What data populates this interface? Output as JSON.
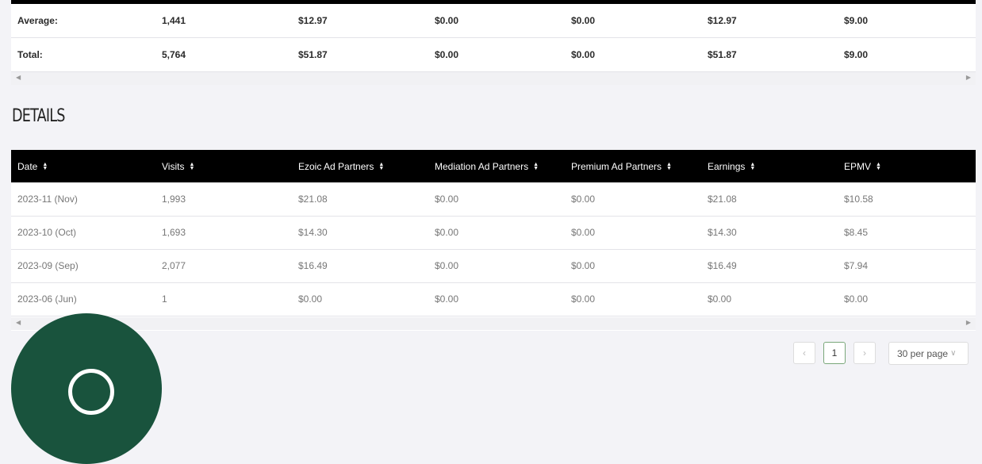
{
  "summary": {
    "rows": [
      {
        "label": "Average:",
        "visits": "1,441",
        "ezoic": "$12.97",
        "mediation": "$0.00",
        "premium": "$0.00",
        "earnings": "$12.97",
        "epmv": "$9.00"
      },
      {
        "label": "Total:",
        "visits": "5,764",
        "ezoic": "$51.87",
        "mediation": "$0.00",
        "premium": "$0.00",
        "earnings": "$51.87",
        "epmv": "$9.00"
      }
    ]
  },
  "details": {
    "title": "DETAILS",
    "headers": [
      "Date",
      "Visits",
      "Ezoic Ad Partners",
      "Mediation Ad Partners",
      "Premium Ad Partners",
      "Earnings",
      "EPMV"
    ],
    "rows": [
      [
        "2023-11 (Nov)",
        "1,993",
        "$21.08",
        "$0.00",
        "$0.00",
        "$21.08",
        "$10.58"
      ],
      [
        "2023-10 (Oct)",
        "1,693",
        "$14.30",
        "$0.00",
        "$0.00",
        "$14.30",
        "$8.45"
      ],
      [
        "2023-09 (Sep)",
        "2,077",
        "$16.49",
        "$0.00",
        "$0.00",
        "$16.49",
        "$7.94"
      ],
      [
        "2023-06 (Jun)",
        "1",
        "$0.00",
        "$0.00",
        "$0.00",
        "$0.00",
        "$0.00"
      ]
    ]
  },
  "pagination": {
    "prev_icon": "‹",
    "current_page": "1",
    "next_icon": "›",
    "per_page": "30 per page"
  },
  "scroll": {
    "left_icon": "◀",
    "right_icon": "▶"
  },
  "icons": {
    "sort": "sort-icon"
  },
  "colors": {
    "header_bg": "#000000",
    "badge": "#19533d",
    "active_page_border": "#7aa77a"
  }
}
